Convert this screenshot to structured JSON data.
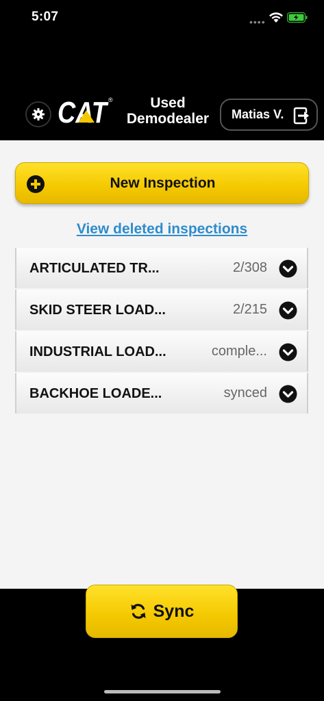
{
  "status_bar": {
    "time": "5:07",
    "signal": "••••",
    "battery_color": "#3ec93e"
  },
  "header": {
    "logo_text": "CAT",
    "dealer_line1": "Used",
    "dealer_line2": "Demodealer",
    "user_name": "Matias V.",
    "icons": {
      "settings": "gear-icon",
      "logout": "logout-icon"
    }
  },
  "actions": {
    "new_inspection_label": "New Inspection",
    "view_deleted_label": "View deleted inspections",
    "sync_label": "Sync"
  },
  "inspections": [
    {
      "title": "ARTICULATED TR...",
      "status": "2/308"
    },
    {
      "title": "SKID STEER LOAD...",
      "status": "2/215"
    },
    {
      "title": "INDUSTRIAL LOAD...",
      "status": "comple..."
    },
    {
      "title": "BACKHOE LOADE...",
      "status": "synced"
    }
  ],
  "colors": {
    "accent_yellow": "#f4c800",
    "link_blue": "#2d8ccc",
    "header_bg": "#000000",
    "content_bg": "#f4f4f4"
  }
}
